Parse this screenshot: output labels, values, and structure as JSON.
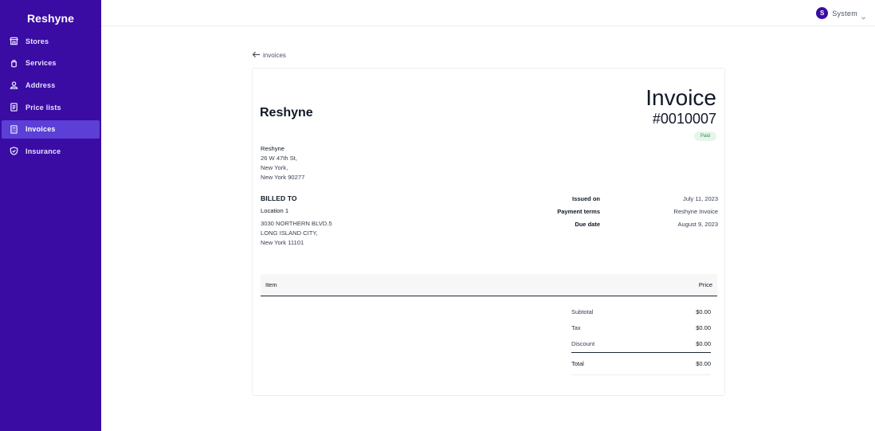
{
  "sidebar": {
    "brand": "Reshyne",
    "items": [
      {
        "label": "Stores",
        "icon": "store-icon"
      },
      {
        "label": "Services",
        "icon": "service-icon"
      },
      {
        "label": "Address",
        "icon": "address-icon"
      },
      {
        "label": "Price lists",
        "icon": "document-icon"
      },
      {
        "label": "Invoices",
        "icon": "invoice-icon",
        "active": true
      },
      {
        "label": "Insurance",
        "icon": "shield-icon"
      }
    ]
  },
  "topbar": {
    "avatar_initial": "S",
    "user_name": "System"
  },
  "back_link": "invoices",
  "invoice": {
    "company_logo": "Reshyne",
    "title": "Invoice",
    "number": "#0010007",
    "status": "Paid",
    "from": {
      "name": "Reshyne",
      "line1": "26 W 47th St,",
      "line2": "New York,",
      "line3": "New York 90277"
    },
    "billed_to": {
      "heading": "BILLED TO",
      "location": "Location 1",
      "line1": "3030 NORTHERN BLVD.5",
      "line2": "LONG ISLAND CITY,",
      "line3": "New York 11101"
    },
    "meta": [
      {
        "label": "Issued on",
        "value": "July 11, 2023"
      },
      {
        "label": "Payment terms",
        "value": "Reshyne Invoice"
      },
      {
        "label": "Due date",
        "value": "August 9, 2023"
      }
    ],
    "table_headers": {
      "item": "Item",
      "price": "Price"
    },
    "totals": [
      {
        "label": "Subtotal",
        "value": "$0.00"
      },
      {
        "label": "Tax",
        "value": "$0.00"
      },
      {
        "label": "Discount",
        "value": "$0.00"
      },
      {
        "label": "Total",
        "value": "$0.00"
      }
    ]
  },
  "colors": {
    "sidebar_bg": "#3a0ca3",
    "sidebar_active": "#5b3fd6",
    "paid_badge_bg": "#e6f6ea",
    "paid_badge_text": "#2f855a"
  }
}
